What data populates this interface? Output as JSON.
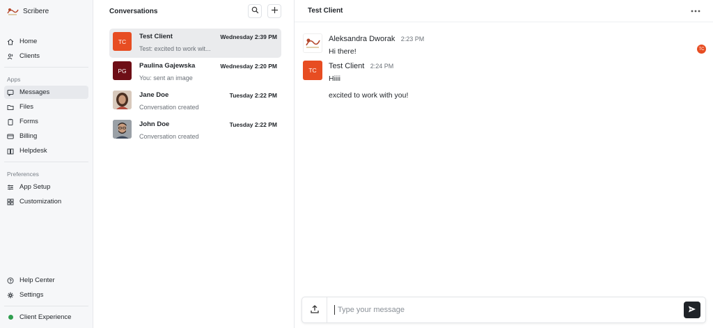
{
  "brand": {
    "name": "Scribere"
  },
  "sidebar": {
    "main_items": [
      {
        "label": "Home",
        "icon": "home-icon"
      },
      {
        "label": "Clients",
        "icon": "users-icon"
      }
    ],
    "apps_label": "Apps",
    "app_items": [
      {
        "label": "Messages",
        "icon": "message-icon",
        "active": true
      },
      {
        "label": "Files",
        "icon": "folder-icon"
      },
      {
        "label": "Forms",
        "icon": "clipboard-icon"
      },
      {
        "label": "Billing",
        "icon": "card-icon"
      },
      {
        "label": "Helpdesk",
        "icon": "book-icon"
      }
    ],
    "preferences_label": "Preferences",
    "pref_items": [
      {
        "label": "App Setup",
        "icon": "sliders-icon"
      },
      {
        "label": "Customization",
        "icon": "grid-icon"
      }
    ],
    "bottom_items": [
      {
        "label": "Help Center",
        "icon": "help-icon"
      },
      {
        "label": "Settings",
        "icon": "gear-icon"
      },
      {
        "label": "Client Experience",
        "icon": "status-dot",
        "status_color": "#2f9e4f"
      }
    ]
  },
  "conversations": {
    "title": "Conversations",
    "items": [
      {
        "initials": "TC",
        "name": "Test Client",
        "preview": "Test: excited to work wit...",
        "time": "Wednesday 2:39 PM",
        "avatar_color": "#e74d22",
        "selected": true
      },
      {
        "initials": "PG",
        "name": "Paulina Gajewska",
        "preview": "You: sent an image",
        "time": "Wednesday 2:20 PM",
        "avatar_color": "#6e0e16"
      },
      {
        "initials": "",
        "name": "Jane Doe",
        "preview": "Conversation created",
        "time": "Tuesday 2:22 PM",
        "avatar_color": "#c69a7e"
      },
      {
        "initials": "",
        "name": "John Doe",
        "preview": "Conversation created",
        "time": "Tuesday 2:22 PM",
        "avatar_color": "#8a8f96"
      }
    ]
  },
  "chat": {
    "title": "Test Client",
    "messages": [
      {
        "author": "Aleksandra Dworak",
        "time": "2:23 PM",
        "lines": [
          "Hi there!"
        ]
      },
      {
        "author": "Test Client",
        "initials": "TC",
        "time": "2:24 PM",
        "lines": [
          "Hiiii",
          "excited to work with you!"
        ]
      }
    ],
    "read_receipt_initials": "TC",
    "composer_placeholder": "Type your message"
  },
  "colors": {
    "accent": "#e74d22",
    "dark": "#1f2328"
  }
}
